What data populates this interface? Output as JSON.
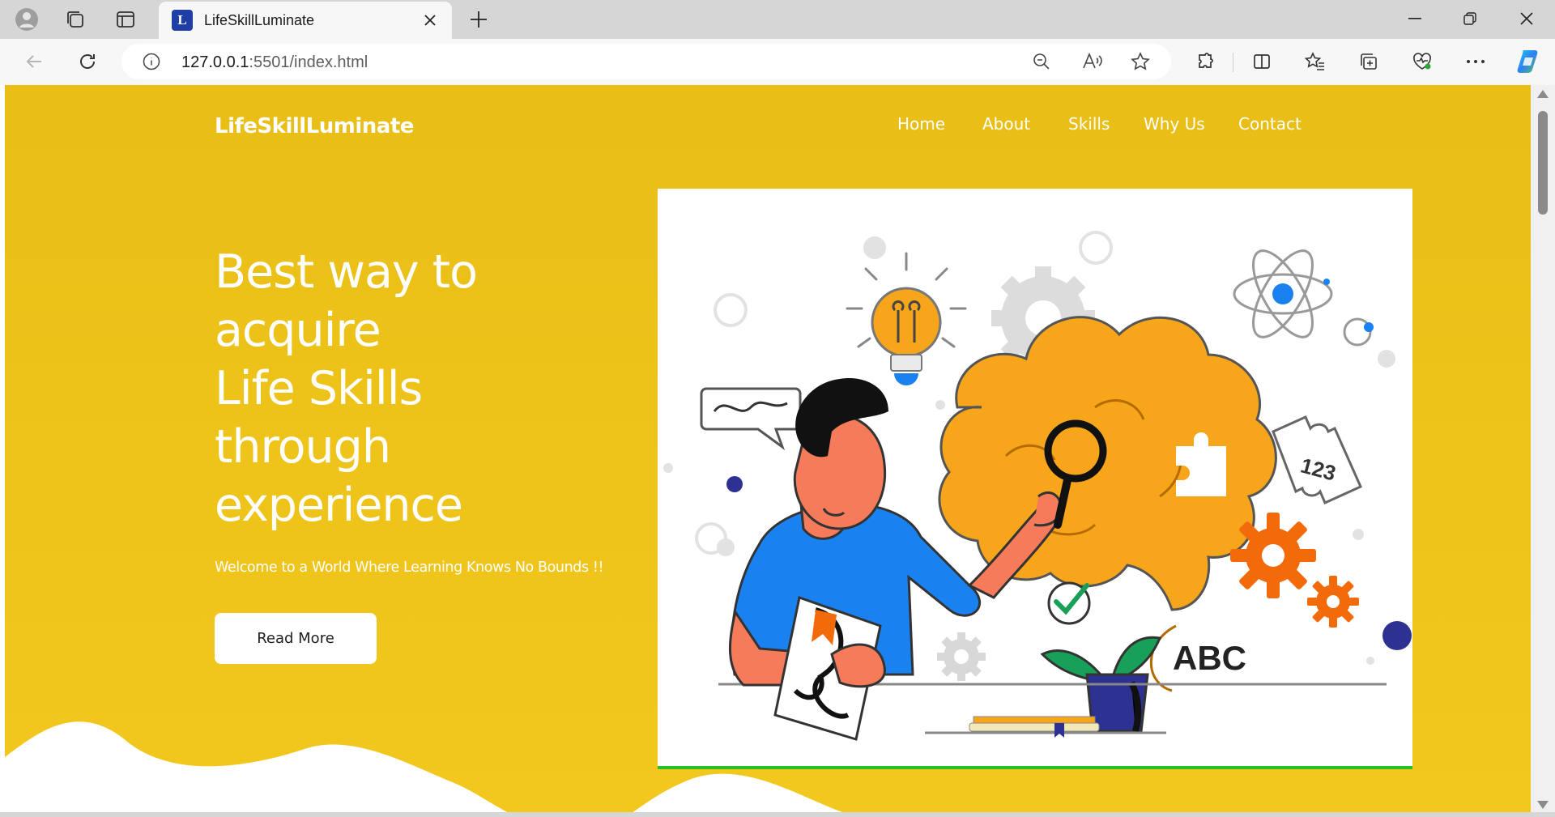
{
  "browser": {
    "tab_title": "LifeSkillLuminate",
    "favicon_letter": "L",
    "url_host": "127.0.0.1",
    "url_rest": ":5501/index.html"
  },
  "site": {
    "brand": "LifeSkillLuminate",
    "nav": [
      "Home",
      "About",
      "Skills",
      "Why Us",
      "Contact"
    ],
    "headline": [
      "Best way to",
      "acquire",
      "Life Skills",
      "through",
      "experience"
    ],
    "subtitle": "Welcome to a World Where Learning Knows No Bounds !!",
    "cta": "Read More",
    "illustration_text": [
      "123",
      "ABC"
    ]
  },
  "colors": {
    "hero": "#eebf1a",
    "accent_orange": "#f7a51a",
    "accent_blue": "#1a82f0",
    "gear_orange": "#f26a0a",
    "underline_green": "#28c020"
  }
}
